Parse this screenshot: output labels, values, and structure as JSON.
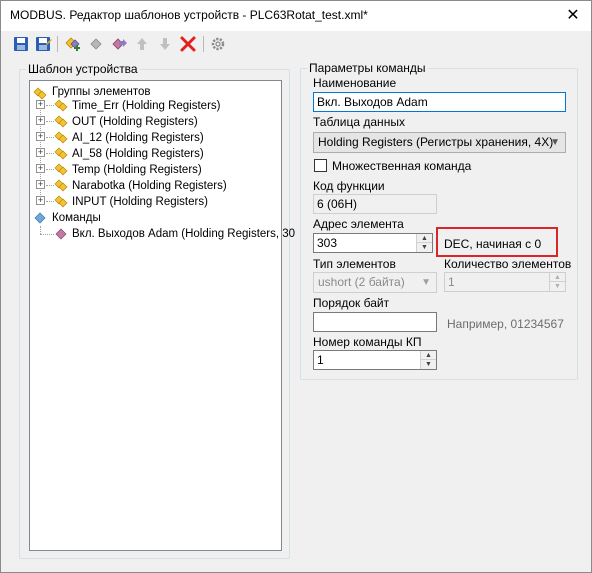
{
  "window": {
    "title": "MODBUS. Редактор шаблонов устройств - PLC63Rotat_test.xml*",
    "close_icon": "close-icon"
  },
  "toolbar": {
    "buttons": [
      {
        "name": "save-icon"
      },
      {
        "name": "save-as-icon"
      },
      {
        "name": "add-element-icon"
      },
      {
        "name": "add-group-icon"
      },
      {
        "name": "add-command-icon"
      },
      {
        "name": "move-up-icon"
      },
      {
        "name": "move-down-icon"
      },
      {
        "name": "delete-icon"
      },
      {
        "name": "settings-icon"
      }
    ]
  },
  "template_panel": {
    "title": "Шаблон устройства",
    "tree": {
      "groups_label": "Группы элементов",
      "groups": [
        "Time_Err (Holding Registers)",
        "OUT (Holding Registers)",
        "AI_12 (Holding Registers)",
        "AI_58 (Holding Registers)",
        "Temp (Holding Registers)",
        "Narabotka (Holding Registers)",
        "INPUT (Holding Registers)"
      ],
      "commands_label": "Команды",
      "commands": [
        "Вкл. Выходов Adam (Holding Registers, 30"
      ]
    }
  },
  "command_params": {
    "title": "Параметры команды",
    "name_label": "Наименование",
    "name_value": "Вкл. Выходов Adam",
    "table_label": "Таблица данных",
    "table_value": "Holding Registers (Регистры хранения, 4X)",
    "multiple_label": "Множественная команда",
    "multiple_checked": false,
    "func_code_label": "Код функции",
    "func_code_value": "6 (06H)",
    "address_label": "Адрес элемента",
    "address_value": "303",
    "address_hint": "DEC, начиная с 0",
    "elem_type_label": "Тип элементов",
    "elem_type_value": "ushort (2 байта)",
    "elem_count_label": "Количество элементов",
    "elem_count_value": "1",
    "byte_order_label": "Порядок байт",
    "byte_order_value": "",
    "byte_order_hint": "Например, 01234567",
    "kp_number_label": "Номер команды КП",
    "kp_number_value": "1"
  },
  "colors": {
    "highlight": "#d9262a",
    "focus_border": "#0078d7"
  }
}
